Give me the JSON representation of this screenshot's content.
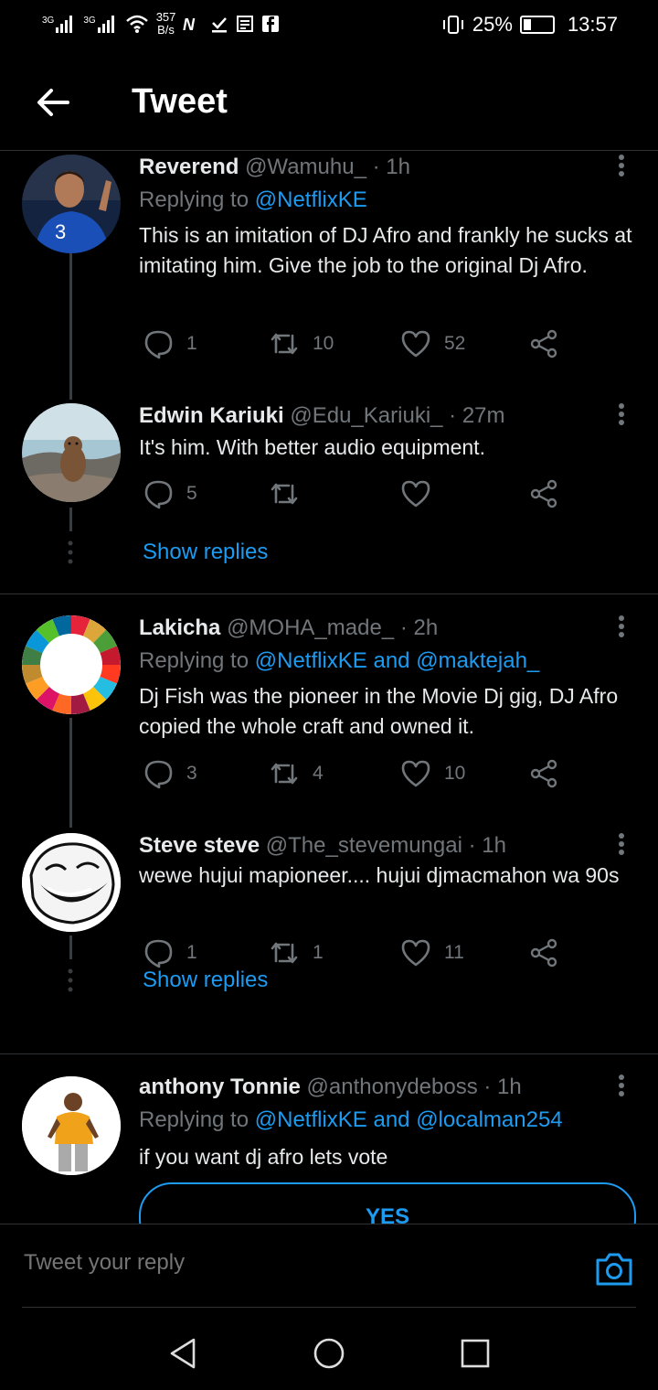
{
  "status": {
    "signal1": "3G",
    "signal2": "3G",
    "speed": "357",
    "speed_unit": "B/s",
    "battery_pct": "25%",
    "battery_level": 0.25,
    "time": "13:57"
  },
  "header": {
    "title": "Tweet"
  },
  "tweets": [
    {
      "name": "Reverend",
      "handle": "@Wamuhu_",
      "time": "· 1h",
      "reply_prefix": "Replying to",
      "reply_links": "@NetflixKE",
      "text": "This is an imitation of DJ Afro and frankly he sucks at imitating him. Give the job to the original Dj Afro.",
      "replies": "1",
      "retweets": "10",
      "likes": "52"
    },
    {
      "name": "Edwin Kariuki",
      "handle": "@Edu_Kariuki_",
      "time": "· 27m",
      "text": "It's him. With better audio equipment.",
      "replies": "5",
      "retweets": "",
      "likes": ""
    },
    {
      "name": "Lakicha",
      "handle": "@MOHA_made_",
      "time": "· 2h",
      "reply_prefix": "Replying to",
      "reply_links": "@NetflixKE and @maktejah_",
      "text": "Dj Fish was the pioneer in the Movie Dj gig, DJ Afro copied the whole craft and owned it.",
      "replies": "3",
      "retweets": "4",
      "likes": "10"
    },
    {
      "name": "Steve steve",
      "handle": "@The_stevemungai",
      "time": "· 1h",
      "text": "wewe hujui mapioneer.... hujui djmacmahon wa 90s",
      "replies": "1",
      "retweets": "1",
      "likes": "11"
    },
    {
      "name": "anthony Tonnie",
      "handle": "@anthonydeboss",
      "time": "· 1h",
      "reply_prefix": "Replying to",
      "reply_links": "@NetflixKE and @localman254",
      "text": "if you want dj afro lets vote",
      "poll_option": "YES"
    }
  ],
  "show_replies_label": "Show replies",
  "composer": {
    "placeholder": "Tweet your reply"
  },
  "colors": {
    "accent": "#1d9bf0",
    "muted": "#71767b",
    "background": "#000000",
    "divider": "#2f3336"
  },
  "icons": [
    "back-arrow-icon",
    "more-vertical-icon",
    "reply-icon",
    "retweet-icon",
    "like-icon",
    "share-icon",
    "camera-icon",
    "nav-back-icon",
    "nav-home-icon",
    "nav-recents-icon"
  ]
}
